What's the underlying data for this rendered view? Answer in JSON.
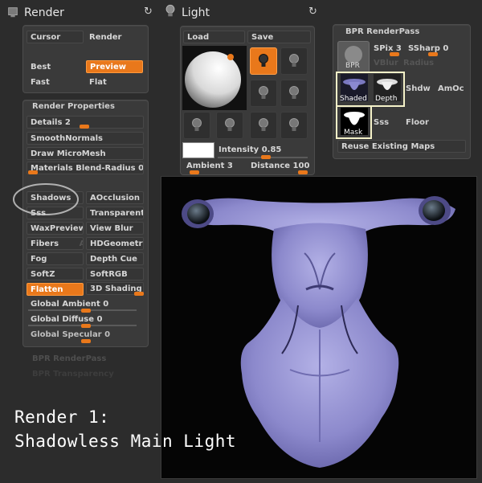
{
  "render": {
    "title": "Render",
    "buttons": {
      "cursor": "Cursor",
      "render": "Render",
      "best": "Best",
      "preview": "Preview",
      "fast": "Fast",
      "flat": "Flat"
    },
    "properties_title": "Render Properties",
    "details": {
      "label": "Details",
      "value": "2"
    },
    "items": [
      "SmoothNormals",
      "Draw MicroMesh"
    ],
    "materials_blend": {
      "label": "Materials Blend-Radius",
      "value": "0"
    },
    "grid": [
      [
        "Shadows",
        "AOcclusion"
      ],
      [
        "Sss",
        "Transparent"
      ],
      [
        "WaxPreview",
        "View Blur"
      ],
      [
        "Fibers",
        "HDGeometry"
      ],
      [
        "Fog",
        "Depth Cue"
      ],
      [
        "SoftZ",
        "SoftRGB"
      ],
      [
        "Flatten",
        "3D Shading"
      ]
    ],
    "fibers_ghost": "Af",
    "global_ambient": {
      "label": "Global Ambient",
      "value": "0"
    },
    "global_diffuse": {
      "label": "Global Diffuse",
      "value": "0"
    },
    "global_specular": {
      "label": "Global Specular",
      "value": "0"
    },
    "faded": [
      "BPR RenderPass",
      "BPR Transparency"
    ]
  },
  "light": {
    "title": "Light",
    "load": "Load",
    "save": "Save",
    "intensity": {
      "label": "Intensity",
      "value": "0.85"
    },
    "ambient": {
      "label": "Ambient",
      "value": "3"
    },
    "distance": {
      "label": "Distance",
      "value": "100"
    }
  },
  "bpr": {
    "title": "BPR RenderPass",
    "bpr_label": "BPR",
    "spix": {
      "label": "SPix",
      "value": "3"
    },
    "ssharp": {
      "label": "SSharp",
      "value": "0"
    },
    "vblur": "VBlur",
    "radius": "Radius",
    "shaded": "Shaded",
    "depth": "Depth",
    "shdw": "Shdw",
    "amoc": "AmOc",
    "mask": "Mask",
    "sss": "Sss",
    "floor": "Floor",
    "reuse": "Reuse Existing Maps"
  },
  "caption": {
    "line1": "Render 1:",
    "line2": "Shadowless Main Light"
  },
  "colors": {
    "accent": "#e9781b",
    "panel": "#3a3a3a",
    "background": "#2c2c2c",
    "highlight": "#f4f1c8"
  }
}
